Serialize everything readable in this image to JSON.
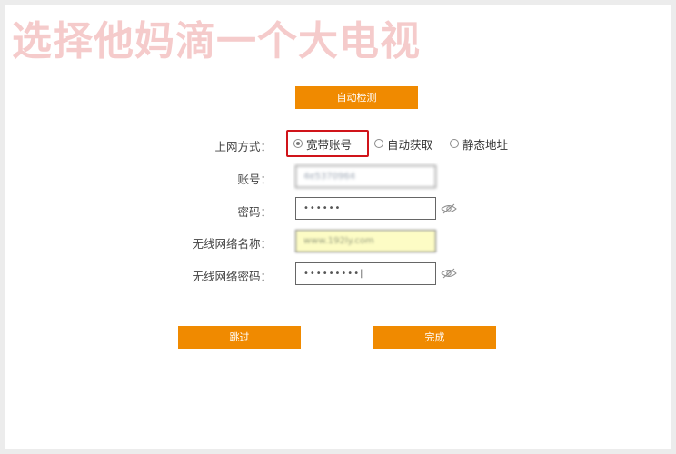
{
  "watermark": "选择他妈滴一个大电视",
  "buttons": {
    "auto_detect": "自动检测",
    "skip": "跳过",
    "done": "完成"
  },
  "form": {
    "connection_type_label": "上网方式：",
    "connection_options": [
      {
        "label": "宽带账号",
        "selected": true
      },
      {
        "label": "自动获取",
        "selected": false
      },
      {
        "label": "静态地址",
        "selected": false
      }
    ],
    "account_label": "账号：",
    "account_value": "4e5370964",
    "password_label": "密码：",
    "password_value": "••••••",
    "ssid_label": "无线网络名称：",
    "ssid_value": "www.192ly.com",
    "wifi_password_label": "无线网络密码：",
    "wifi_password_value": "•••••••••|"
  },
  "colors": {
    "button_bg": "#f08a00",
    "highlight_border": "#d0141a",
    "ssid_field_bg": "#fdfcc5"
  },
  "icons": {
    "password_toggle": "eye-slash-icon",
    "wifi_password_toggle": "eye-slash-icon"
  }
}
